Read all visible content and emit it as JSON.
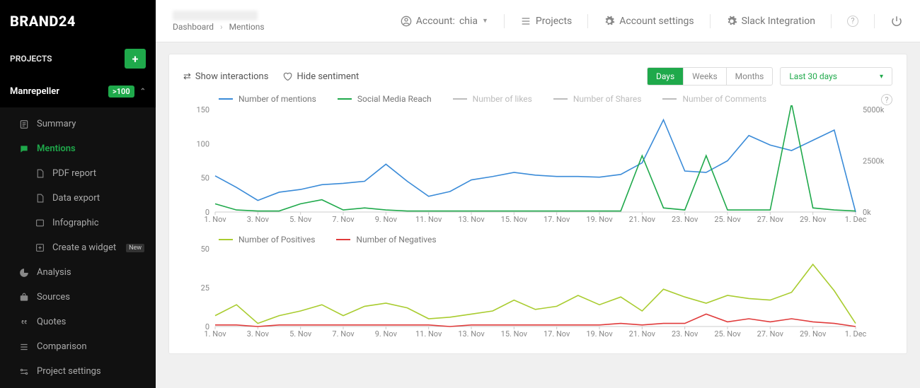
{
  "brand": "BRAND24",
  "sidebar": {
    "projects_label": "PROJECTS",
    "project_name": "Manrepeller",
    "project_badge": ">100",
    "items": [
      {
        "label": "Summary"
      },
      {
        "label": "Mentions"
      },
      {
        "label": "PDF report"
      },
      {
        "label": "Data export"
      },
      {
        "label": "Infographic"
      },
      {
        "label": "Create a widget",
        "badge": "New"
      },
      {
        "label": "Analysis"
      },
      {
        "label": "Sources"
      },
      {
        "label": "Quotes"
      },
      {
        "label": "Comparison"
      },
      {
        "label": "Project settings"
      }
    ]
  },
  "breadcrumb": {
    "root": "Dashboard",
    "current": "Mentions"
  },
  "topbar": {
    "account_prefix": "Account:",
    "account_name": "chia",
    "projects": "Projects",
    "account_settings": "Account settings",
    "slack": "Slack Integration"
  },
  "card": {
    "show_interactions": "Show interactions",
    "hide_sentiment": "Hide sentiment",
    "seg": {
      "days": "Days",
      "weeks": "Weeks",
      "months": "Months"
    },
    "range": "Last 30 days"
  },
  "chart_data": [
    {
      "type": "line",
      "title": "",
      "xlabel": "",
      "ylabel": "",
      "categories": [
        "1. Nov",
        "2. Nov",
        "3. Nov",
        "4. Nov",
        "5. Nov",
        "6. Nov",
        "7. Nov",
        "8. Nov",
        "9. Nov",
        "10. Nov",
        "11. Nov",
        "12. Nov",
        "13. Nov",
        "14. Nov",
        "15. Nov",
        "16. Nov",
        "17. Nov",
        "18. Nov",
        "19. Nov",
        "20. Nov",
        "21. Nov",
        "22. Nov",
        "23. Nov",
        "24. Nov",
        "25. Nov",
        "26. Nov",
        "27. Nov",
        "28. Nov",
        "29. Nov",
        "30. Nov",
        "1. Dec"
      ],
      "tick_every": 2,
      "y_left_ticks": [
        0,
        50,
        100,
        150
      ],
      "y_right_ticks": [
        "0k",
        "2500k",
        "5000k"
      ],
      "ylim": [
        0,
        150
      ],
      "legend": [
        {
          "name": "Number of mentions",
          "color": "#3a8bd8",
          "active": true
        },
        {
          "name": "Social Media Reach",
          "color": "#1fa94b",
          "active": true
        },
        {
          "name": "Number of likes",
          "color": "#bdbdbd",
          "active": false
        },
        {
          "name": "Number of Shares",
          "color": "#bdbdbd",
          "active": false
        },
        {
          "name": "Number of Comments",
          "color": "#bdbdbd",
          "active": false
        }
      ],
      "series": [
        {
          "name": "Number of mentions",
          "color": "#3a8bd8",
          "axis": "left",
          "values": [
            53,
            36,
            17,
            29,
            33,
            40,
            42,
            45,
            70,
            45,
            23,
            30,
            47,
            52,
            58,
            54,
            52,
            52,
            51,
            55,
            72,
            135,
            60,
            58,
            75,
            112,
            98,
            90,
            105,
            120,
            0
          ]
        },
        {
          "name": "Social Media Reach",
          "color": "#1fa94b",
          "axis": "right",
          "values": [
            400,
            100,
            50,
            50,
            400,
            600,
            100,
            200,
            100,
            50,
            50,
            50,
            50,
            50,
            50,
            50,
            50,
            50,
            50,
            50,
            2750,
            200,
            100,
            2750,
            100,
            100,
            100,
            5300,
            200,
            100,
            50
          ]
        }
      ]
    },
    {
      "type": "line",
      "categories": [
        "1. Nov",
        "2. Nov",
        "3. Nov",
        "4. Nov",
        "5. Nov",
        "6. Nov",
        "7. Nov",
        "8. Nov",
        "9. Nov",
        "10. Nov",
        "11. Nov",
        "12. Nov",
        "13. Nov",
        "14. Nov",
        "15. Nov",
        "16. Nov",
        "17. Nov",
        "18. Nov",
        "19. Nov",
        "20. Nov",
        "21. Nov",
        "22. Nov",
        "23. Nov",
        "24. Nov",
        "25. Nov",
        "26. Nov",
        "27. Nov",
        "28. Nov",
        "29. Nov",
        "30. Nov",
        "1. Dec"
      ],
      "tick_every": 2,
      "y_left_ticks": [
        0,
        25,
        50
      ],
      "ylim": [
        0,
        50
      ],
      "legend": [
        {
          "name": "Number of Positives",
          "color": "#a9cc2f",
          "active": true
        },
        {
          "name": "Number of Negatives",
          "color": "#e03b3b",
          "active": true
        }
      ],
      "series": [
        {
          "name": "Number of Positives",
          "color": "#a9cc2f",
          "values": [
            7,
            14,
            2,
            7,
            10,
            14,
            7,
            13,
            15,
            12,
            5,
            6,
            8,
            10,
            17,
            11,
            13,
            20,
            14,
            19,
            10,
            24,
            19,
            15,
            20,
            18,
            17,
            22,
            40,
            23,
            2
          ]
        },
        {
          "name": "Number of Negatives",
          "color": "#e03b3b",
          "values": [
            1,
            1,
            0,
            1,
            1,
            1,
            1,
            1,
            1,
            1,
            1,
            0,
            1,
            1,
            1,
            1,
            1,
            1,
            1,
            2,
            1,
            2,
            2,
            8,
            3,
            5,
            3,
            5,
            3,
            2,
            0
          ]
        }
      ]
    }
  ]
}
